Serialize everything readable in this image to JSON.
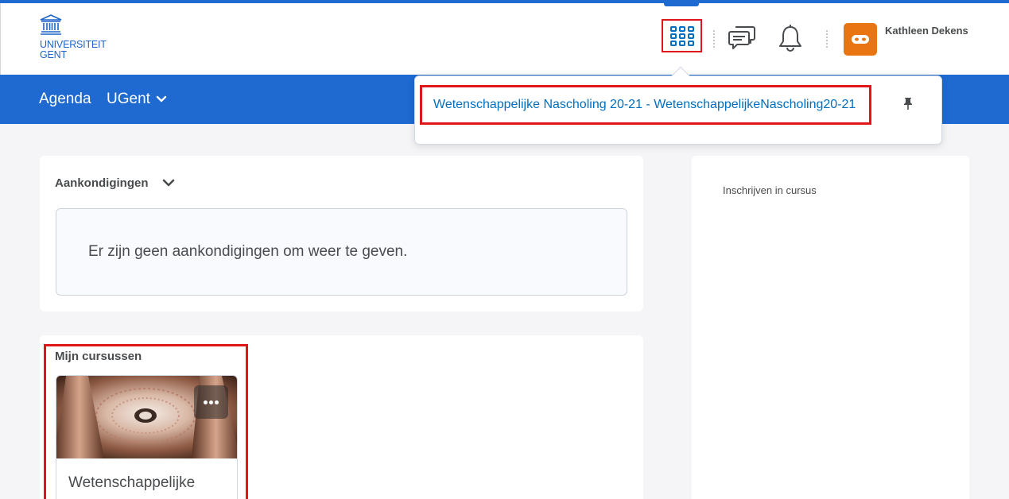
{
  "header": {
    "logo_line1": "UNIVERSITEIT",
    "logo_line2": "GENT",
    "user_name": "Kathleen Dekens",
    "icons": [
      "course-selector-grid-icon",
      "message-alerts-icon",
      "notifications-bell-icon",
      "user-avatar-icon"
    ]
  },
  "navbar": {
    "items": [
      {
        "label": "Agenda"
      },
      {
        "label": "UGent"
      }
    ]
  },
  "course_dropdown": {
    "course_link": "Wetenschappelijke Nascholing 20-21 - WetenschappelijkeNascholing20-21",
    "pin_icon": "pin-icon"
  },
  "announcements": {
    "title": "Aankondigingen",
    "empty_message": "Er zijn geen aankondigingen om weer te geven."
  },
  "my_courses": {
    "title": "Mijn cursussen",
    "courses": [
      {
        "name": "Wetenschappelijke"
      }
    ]
  },
  "sidebar": {
    "enroll_label": "Inschrijven in cursus"
  },
  "colors": {
    "brand_blue": "#1e6ad1",
    "link_blue": "#006fbf",
    "highlight_red": "#e0161b",
    "avatar_orange": "#e87511"
  }
}
